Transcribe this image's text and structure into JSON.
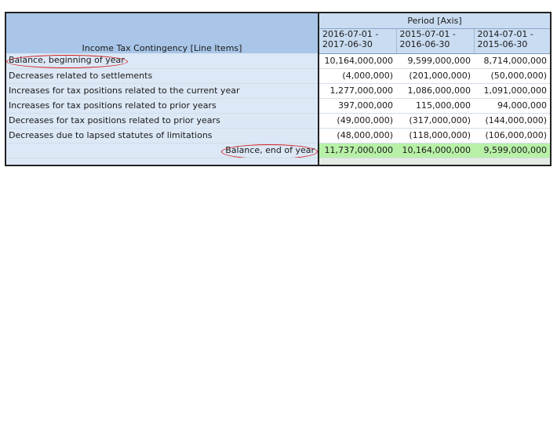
{
  "table": {
    "axis_header": "Period [Axis]",
    "line_items_header": "Income Tax Contingency [Line Items]",
    "periods": [
      {
        "start": "2016-07-01 -",
        "end": "2017-06-30"
      },
      {
        "start": "2015-07-01 -",
        "end": "2016-06-30"
      },
      {
        "start": "2014-07-01 -",
        "end": "2015-06-30"
      }
    ],
    "rows": [
      {
        "label": "Balance, beginning of year",
        "values": [
          "10,164,000,000",
          "9,599,000,000",
          "8,714,000,000"
        ]
      },
      {
        "label": "Decreases related to settlements",
        "values": [
          "(4,000,000)",
          "(201,000,000)",
          "(50,000,000)"
        ]
      },
      {
        "label": "Increases for tax positions related to the current year",
        "values": [
          "1,277,000,000",
          "1,086,000,000",
          "1,091,000,000"
        ]
      },
      {
        "label": "Increases for tax positions related to prior years",
        "values": [
          "397,000,000",
          "115,000,000",
          "94,000,000"
        ]
      },
      {
        "label": "Decreases for tax positions related to prior years",
        "values": [
          "(49,000,000)",
          "(317,000,000)",
          "(144,000,000)"
        ]
      },
      {
        "label": "Decreases due to lapsed statutes of limitations",
        "values": [
          "(48,000,000)",
          "(118,000,000)",
          "(106,000,000)"
        ]
      },
      {
        "label": "Balance, end of year",
        "values": [
          "11,737,000,000",
          "10,164,000,000",
          "9,599,000,000"
        ]
      }
    ]
  },
  "colors": {
    "header_blue": "#a9c6e8",
    "label_bg": "#dce8f6",
    "total_green": "#b8f0a8",
    "annotation_red": "#d12020"
  }
}
